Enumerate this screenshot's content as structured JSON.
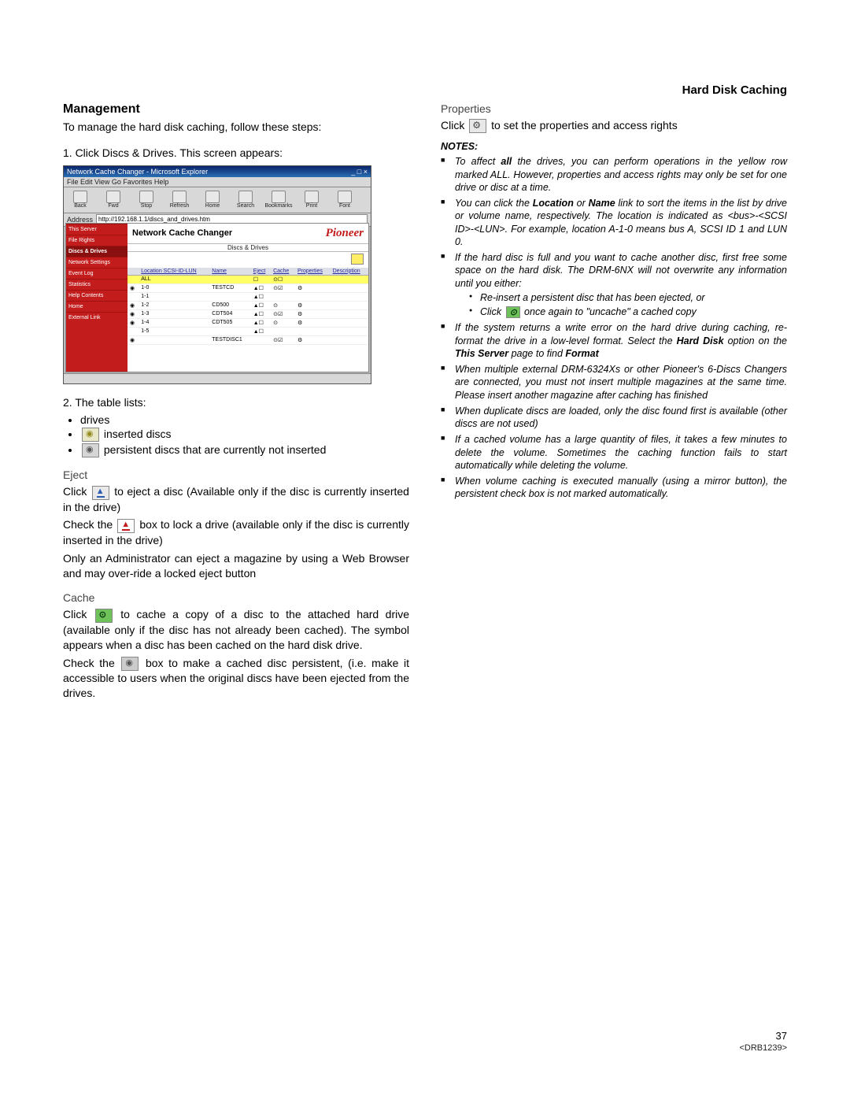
{
  "header": {
    "title": "Hard Disk Caching"
  },
  "left": {
    "heading": "Management",
    "intro": "To manage the hard disk caching, follow these steps:",
    "step1": "1. Click Discs & Drives. This screen appears:",
    "step2": "2. The table lists:",
    "bullets": {
      "drives": "drives",
      "inserted": "inserted discs",
      "persistent": "persistent discs that are currently not inserted"
    },
    "eject": {
      "h": "Eject",
      "p1a": "Click ",
      "p1b": " to eject a disc  (Available only if the disc is currently inserted in the drive)",
      "p2a": "Check the ",
      "p2b": " box to lock a drive (available only if the disc is currently inserted in the drive)",
      "p3": "Only an Administrator can eject a magazine by using a Web Browser and may over-ride a locked eject button"
    },
    "cache": {
      "h": "Cache",
      "p1a": "Click ",
      "p1b": " to cache a copy of a disc to the attached hard drive (available only if the disc has not already been cached). The symbol appears when a disc has been cached on the hard disk drive.",
      "p2a": "Check the ",
      "p2b": " box to make a cached disc persistent, (i.e. make it accessible to users when the original discs have been ejected from the drives."
    }
  },
  "right": {
    "props_h": "Properties",
    "props_a": "Click ",
    "props_b": " to set the properties and access rights",
    "notes_h": "NOTES:",
    "n1a": "To affect ",
    "n1b": "all",
    "n1c": " the drives, you can perform operations in the yellow row marked ALL. However, properties and access rights may only be set for one drive or disc at a time.",
    "n2a": "You can click the ",
    "n2b": "Location",
    "n2c": " or ",
    "n2d": "Name",
    "n2e": " link to sort the items in the list by drive or volume name, respectively. The location is indicated as <bus>-<SCSI ID>-<LUN>. For example, location A-1-0 means bus A, SCSI ID 1 and LUN 0.",
    "n3": "If the hard disc is full and you want to cache another disc, first free some space on the hard disk.  The DRM-6NX will not overwrite any information until you either:",
    "n3s1": "Re-insert a persistent disc that has been ejected, or",
    "n3s2a": "Click ",
    "n3s2b": " once again to \"uncache\" a cached copy",
    "n4a": "If the system returns a write error on the hard drive during caching, re-format the drive in a low-level format.  Select the ",
    "n4b": "Hard Disk",
    "n4c": " option on the ",
    "n4d": "This Server",
    "n4e": " page to find ",
    "n4f": "Format",
    "n5": "When multiple external DRM-6324Xs or other Pioneer's 6-Discs Changers are connected, you must not insert multiple magazines at the same time. Please insert another magazine after caching has finished",
    "n6": "When duplicate discs are loaded, only the disc found first is available (other discs are not used)",
    "n7": "If a cached volume has a large quantity of files, it takes a few minutes to delete the volume. Sometimes the caching function fails to start automatically while deleting the volume.",
    "n8": "When volume caching is executed manually (using a mirror button), the persistent check box is not marked automatically."
  },
  "screenshot": {
    "title": "Network Cache Changer - Microsoft Explorer",
    "menus": "File  Edit  View  Go  Favorites  Help",
    "toolbar": [
      "Back",
      "Fwd",
      "Stop",
      "Refresh",
      "Home",
      "Search",
      "Bookmarks",
      "Print",
      "Font"
    ],
    "addr_label": "Address",
    "addr_value": "http://192.168.1.1/discs_and_drives.htm",
    "app_title": "Network Cache Changer",
    "brand": "Pioneer",
    "subtitle": "Discs & Drives",
    "sidebar": [
      "This Server",
      "File Rights",
      "Discs & Drives",
      "Network Settings",
      "Event Log",
      "Statistics",
      "Help Contents",
      "Home",
      "External Link"
    ],
    "cols": [
      "",
      "Location SCSI-ID-LUN",
      "Name",
      "Eject",
      "Cache",
      "Properties",
      "Description"
    ],
    "rows": [
      {
        "loc": "ALL",
        "name": "",
        "all": true
      },
      {
        "loc": "1-0",
        "name": "TESTCD"
      },
      {
        "loc": "1-1",
        "name": ""
      },
      {
        "loc": "1-2",
        "name": "CD500"
      },
      {
        "loc": "1-3",
        "name": "CDT504"
      },
      {
        "loc": "1-4",
        "name": "CDT505"
      },
      {
        "loc": "1-5",
        "name": ""
      },
      {
        "loc": "",
        "name": "TESTDISC1"
      }
    ]
  },
  "footer": {
    "page": "37",
    "doc": "<DRB1239>"
  }
}
